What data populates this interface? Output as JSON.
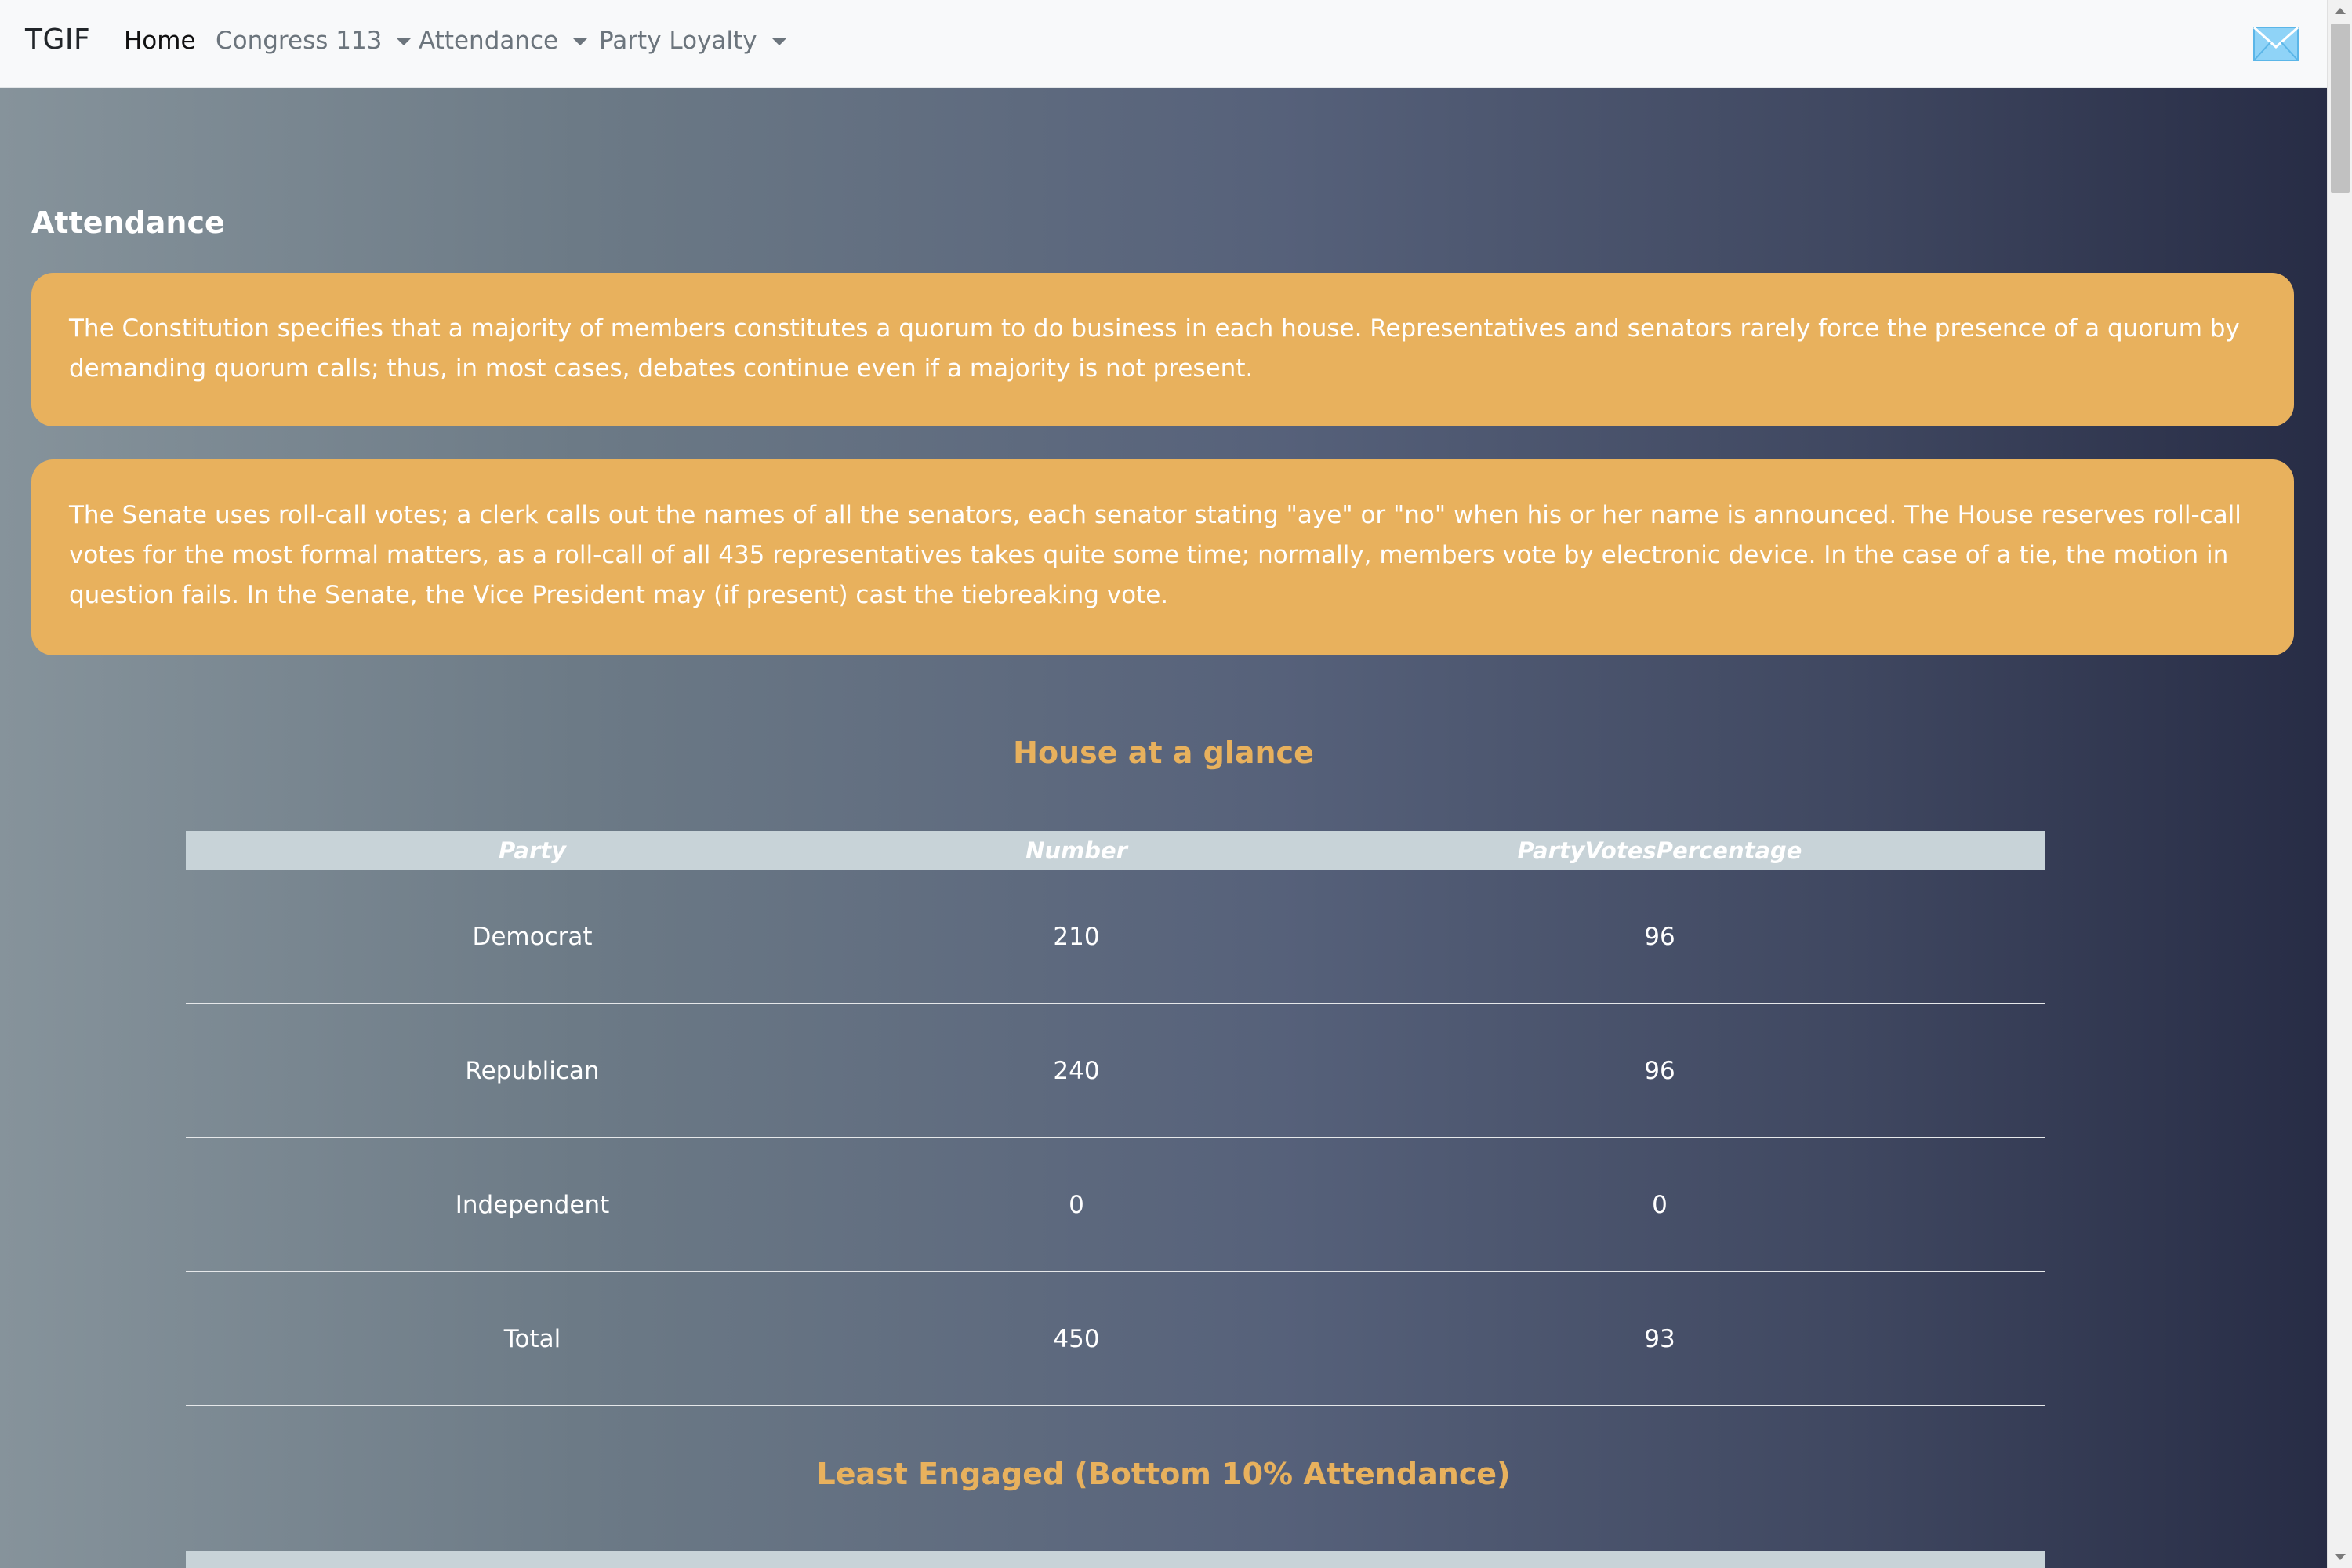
{
  "nav": {
    "brand": "TGIF",
    "items": [
      {
        "label": "Home",
        "dropdown": false
      },
      {
        "label": "Congress 113",
        "dropdown": true
      },
      {
        "label": "Attendance",
        "dropdown": true
      },
      {
        "label": "Party Loyalty",
        "dropdown": true
      }
    ],
    "mail_icon": "envelope-icon"
  },
  "page": {
    "heading": "Attendance",
    "info": [
      "The Constitution specifies that a majority of members constitutes a quorum to do business in each house. Representatives and senators rarely force the presence of a quorum by demanding quorum calls; thus, in most cases, debates continue even if a majority is not present.",
      "The Senate uses roll-call votes; a clerk calls out the names of all the senators, each senator stating \"aye\" or \"no\" when his or her name is announced. The House reserves roll-call votes for the most formal matters, as a roll-call of all 435 representatives takes quite some time; normally, members vote by electronic device. In the case of a tie, the motion in question fails. In the Senate, the Vice President may (if present) cast the tiebreaking vote."
    ]
  },
  "glance": {
    "title": "House at a glance",
    "headers": [
      "Party",
      "Number",
      "PartyVotesPercentage"
    ],
    "rows": [
      [
        "Democrat",
        "210",
        "96"
      ],
      [
        "Republican",
        "240",
        "96"
      ],
      [
        "Independent",
        "0",
        "0"
      ],
      [
        "Total",
        "450",
        "93"
      ]
    ]
  },
  "least_engaged": {
    "title": "Least Engaged (Bottom 10% Attendance)"
  },
  "colors": {
    "accent": "#e8b15d",
    "navbar_bg": "#f8f9fa",
    "table_header_bg": "#c8d3d8",
    "gradient_start": "#86939b",
    "gradient_end": "#272c45"
  }
}
